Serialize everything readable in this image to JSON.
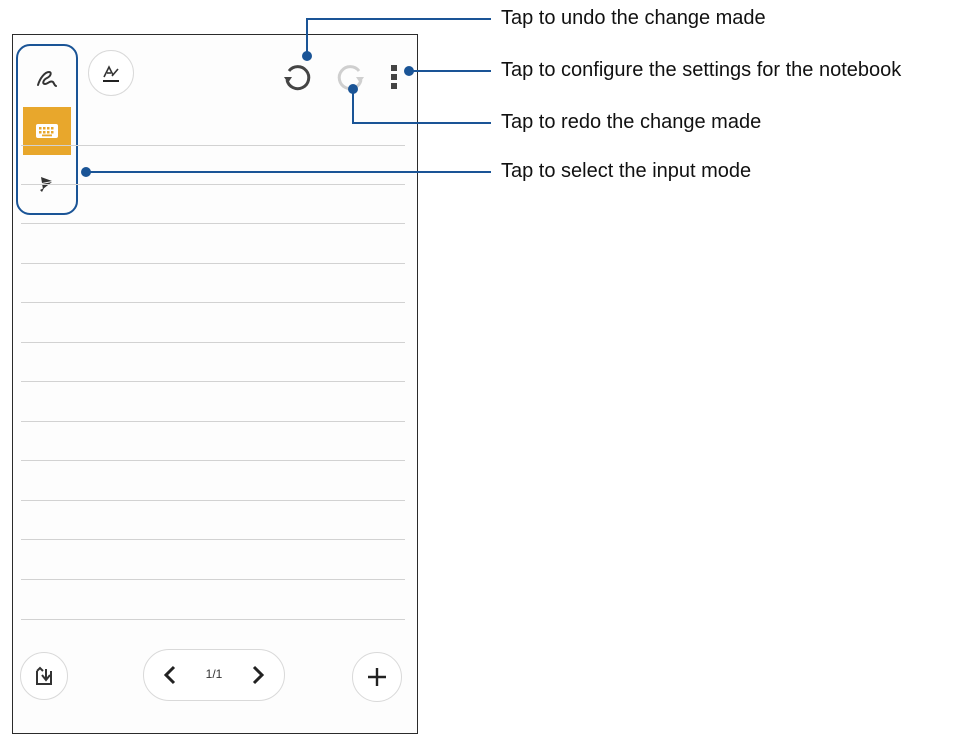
{
  "app": {
    "accent_color": "#e8a72c",
    "callout_color": "#1a5496",
    "icons": {
      "handwriting_mode": "handwriting-scribble-icon",
      "typing_mode": "keyboard-icon",
      "drawing_mode": "brush-icon",
      "pen_style": "pen-style-icon",
      "undo": "undo-icon",
      "redo": "redo-icon",
      "settings": "more-vertical-icon",
      "insert": "insert-into-icon",
      "prev_page": "chevron-left-icon",
      "next_page": "chevron-right-icon",
      "add_page": "plus-icon"
    },
    "page_indicator": "1/1"
  },
  "callouts": {
    "undo": "Tap to undo the change made",
    "settings": "Tap to configure the settings for the notebook",
    "redo": "Tap to redo the change made",
    "input_mode": "Tap to select the input mode"
  }
}
